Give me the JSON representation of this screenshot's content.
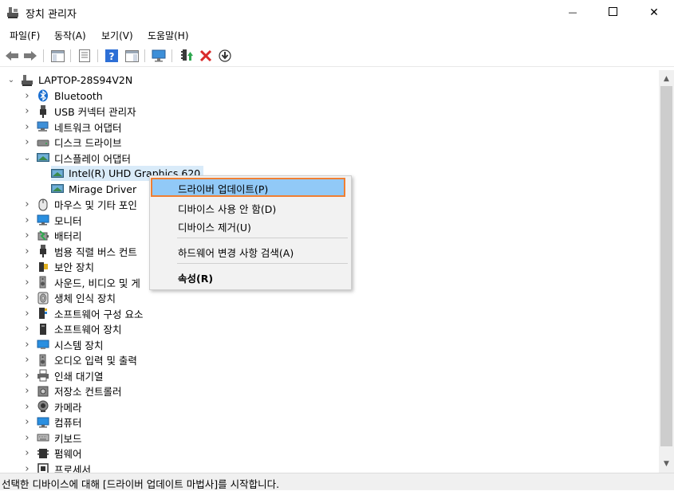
{
  "window": {
    "title": "장치 관리자",
    "minimize_glyph": "—",
    "close_glyph": "✕"
  },
  "menu": [
    "파일(F)",
    "동작(A)",
    "보기(V)",
    "도움말(H)"
  ],
  "tree": {
    "root": "LAPTOP-28S94V2N",
    "items": [
      {
        "label": "Bluetooth",
        "icon": "bluetooth-icon",
        "expanded": false
      },
      {
        "label": "USB 커넥터 관리자",
        "icon": "usb-icon",
        "expanded": false
      },
      {
        "label": "네트워크 어댑터",
        "icon": "network-icon",
        "expanded": false
      },
      {
        "label": "디스크 드라이브",
        "icon": "disk-icon",
        "expanded": false
      },
      {
        "label": "디스플레이 어댑터",
        "icon": "display-adapter-icon",
        "expanded": true
      },
      {
        "label": "Intel(R) UHD Graphics 620",
        "icon": "display-adapter-icon",
        "child": true,
        "selected": true
      },
      {
        "label": "Mirage Driver",
        "icon": "display-adapter-icon",
        "child": true
      },
      {
        "label": "마우스 및 기타 포인",
        "icon": "mouse-icon",
        "expanded": false
      },
      {
        "label": "모니터",
        "icon": "monitor-icon",
        "expanded": false
      },
      {
        "label": "배터리",
        "icon": "battery-icon",
        "expanded": false
      },
      {
        "label": "범용 직렬 버스 컨트",
        "icon": "usb-icon",
        "expanded": false
      },
      {
        "label": "보안 장치",
        "icon": "security-icon",
        "expanded": false
      },
      {
        "label": "사운드, 비디오 및 게",
        "icon": "speaker-icon",
        "expanded": false
      },
      {
        "label": "생체 인식 장치",
        "icon": "fingerprint-icon",
        "expanded": false
      },
      {
        "label": "소프트웨어 구성 요소",
        "icon": "software-component-icon",
        "expanded": false
      },
      {
        "label": "소프트웨어 장치",
        "icon": "software-device-icon",
        "expanded": false
      },
      {
        "label": "시스템 장치",
        "icon": "system-icon",
        "expanded": false
      },
      {
        "label": "오디오 입력 및 출력",
        "icon": "speaker-icon",
        "expanded": false
      },
      {
        "label": "인쇄 대기열",
        "icon": "printer-icon",
        "expanded": false
      },
      {
        "label": "저장소 컨트롤러",
        "icon": "storage-icon",
        "expanded": false
      },
      {
        "label": "카메라",
        "icon": "camera-icon",
        "expanded": false
      },
      {
        "label": "컴퓨터",
        "icon": "computer-icon",
        "expanded": false
      },
      {
        "label": "키보드",
        "icon": "keyboard-icon",
        "expanded": false
      },
      {
        "label": "펌웨어",
        "icon": "firmware-icon",
        "expanded": false
      },
      {
        "label": "프로세서",
        "icon": "processor-icon",
        "expanded": false
      }
    ]
  },
  "context_menu": {
    "update_driver": "드라이버 업데이트(P)",
    "disable_device": "디바이스 사용 안 함(D)",
    "uninstall_device": "디바이스 제거(U)",
    "scan_hardware": "하드웨어 변경 사항 검색(A)",
    "properties": "속성(R)"
  },
  "status": "선택한 디바이스에 대해 [드라이버 업데이트 마법사]를 시작합니다.",
  "colors": {
    "selection": "#d9ebf9",
    "menu_highlight": "#91c9f7",
    "highlight_border": "#f07f32",
    "error_red": "#d92b2b"
  }
}
